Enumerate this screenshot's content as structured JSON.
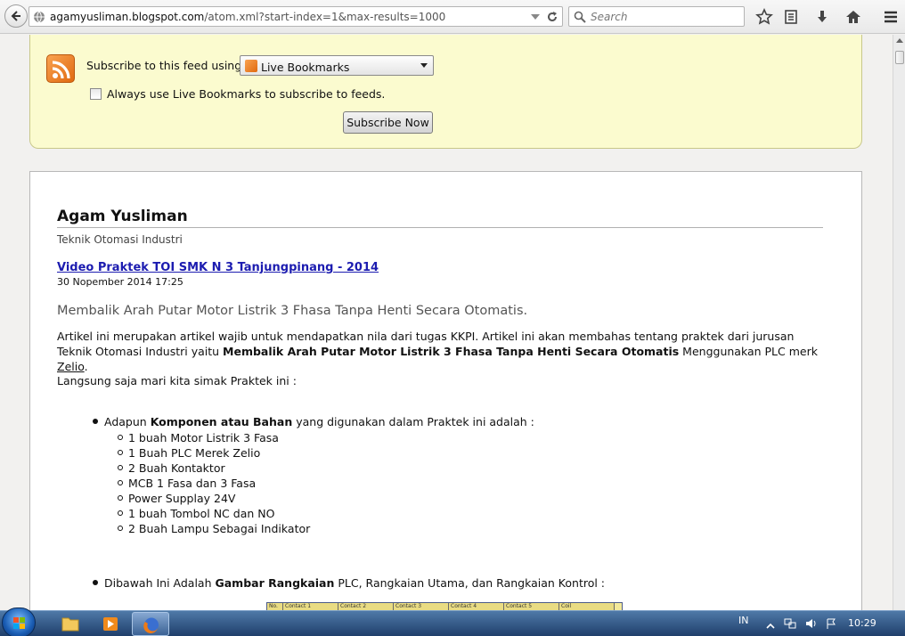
{
  "browser": {
    "url_host": "agamyusliman.blogspot.com",
    "url_path": "/atom.xml?start-index=1&max-results=1000",
    "search_placeholder": "Search"
  },
  "feed_subscribe": {
    "label": "Subscribe to this feed using",
    "selected_reader": "Live Bookmarks",
    "always_use_label": "Always use Live Bookmarks to subscribe to feeds.",
    "always_use_checked": false,
    "subscribe_button": "Subscribe Now"
  },
  "blog": {
    "title": "Agam Yusliman",
    "subtitle": "Teknik Otomasi Industri"
  },
  "post": {
    "title": "Video Praktek TOI SMK N 3 Tanjungpinang - 2014",
    "date": "30 Nopember 2014 17:25",
    "heading": "Membalik Arah  Putar Motor Listrik 3 Fhasa Tanpa Henti Secara Otomatis.",
    "para1_a": "Artikel ini merupakan artikel wajib untuk mendapatkan nila dari tugas KKPI. Artikel ini akan membahas tentang praktek dari jurusan Teknik Otomasi Industri yaitu ",
    "para1_bold": "Membalik Arah  Putar Motor Listrik 3 Fhasa Tanpa Henti Secara Otomatis",
    "para1_b": " Menggunakan PLC merk ",
    "para1_link": "Zelio",
    "para1_end": ".",
    "para2": "Langsung saja mari kita simak Praktek ini :",
    "bullet1_a": "Adapun ",
    "bullet1_bold": "Komponen atau Bahan",
    "bullet1_b": " yang digunakan dalam Praktek ini adalah :",
    "components": [
      "1 buah Motor Listrik 3 Fasa",
      "1 Buah PLC Merek Zelio",
      "2 Buah Kontaktor",
      "MCB 1 Fasa dan 3 Fasa",
      "Power Supplay 24V",
      "1 buah Tombol NC dan NO",
      "2 Buah Lampu Sebagai Indikator"
    ],
    "bullet2_a": "Dibawah Ini Adalah ",
    "bullet2_bold": "Gambar Rangkaian",
    "bullet2_b": " PLC, Rangkaian Utama, dan Rangkaian Kontrol :",
    "image_headers": [
      "No.",
      "Contact 1",
      "Contact 2",
      "Contact 3",
      "Contact 4",
      "Contact 5",
      "Coil"
    ]
  },
  "taskbar": {
    "language": "IN",
    "time": "10:29"
  },
  "colors": {
    "feed_box_bg": "#fbfbcf",
    "link": "#1c1cb0",
    "taskbar": "#1f3f6b"
  }
}
